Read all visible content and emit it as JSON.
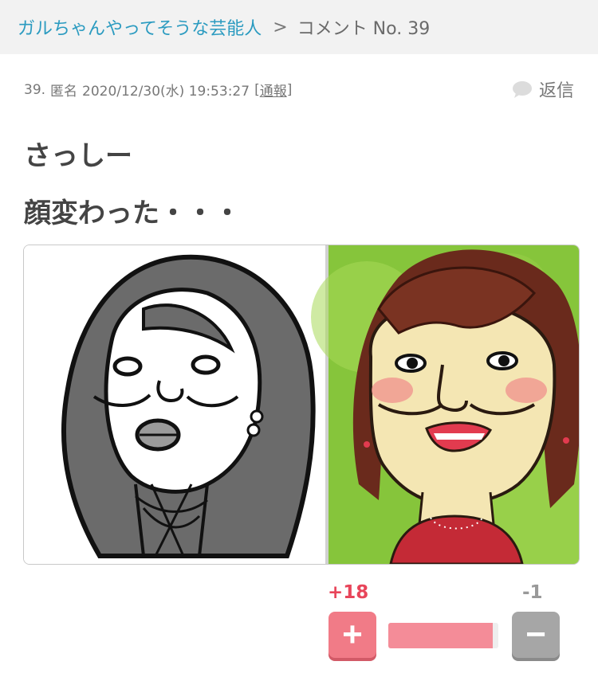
{
  "breadcrumb": {
    "parent": "ガルちゃんやってそうな芸能人",
    "separator": ">",
    "current": "コメント No. 39"
  },
  "comment": {
    "number": "39.",
    "author": "匿名",
    "timestamp": "2020/12/30(水) 19:53:27",
    "report_label": "通報",
    "reply_label": "返信",
    "reply_icon": "speech-bubble-icon",
    "body_lines": [
      "さっしー",
      "顔変わった・・・"
    ]
  },
  "votes": {
    "plus_score": "+18",
    "minus_score": "-1",
    "plus_label": "+",
    "minus_label": "−",
    "plus_ratio": 0.947,
    "colors": {
      "plus": "#f17b87",
      "minus": "#a6a6a6",
      "link": "#2b9bc0"
    }
  }
}
